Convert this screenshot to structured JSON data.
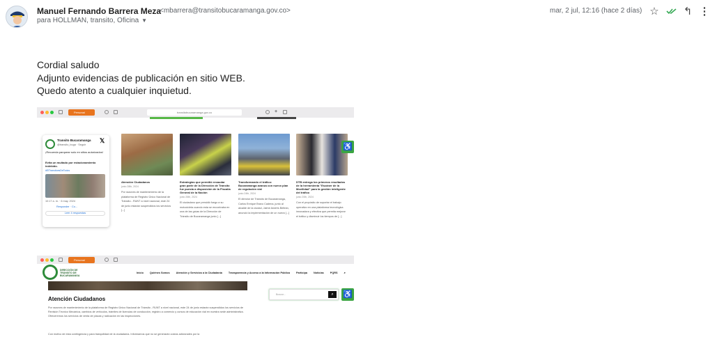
{
  "email": {
    "sender_name": "Manuel Fernando Barrera Meza",
    "sender_email": "<mbarrera@transitobucaramanga.gov.co>",
    "recipients": "para HOLLMAN, transito, Oficina",
    "date": "mar, 2 jul, 12:16 (hace 2 días)",
    "icons": [
      "star-icon",
      "read-check-icon",
      "reply-icon",
      "more-vert-icon"
    ],
    "body_lines": [
      "Cordial saludo",
      "Adjunto evidencias de publicación en sitio WEB.",
      "Quedo atento a cualquier inquietud."
    ]
  },
  "screenshot1": {
    "tab_label": "Personal",
    "url": "transitobucaramanga.gov.co",
    "tweet": {
      "name": "Transito Bucaramanga",
      "handle": "@transito_buga · Seguir",
      "line1": "¡Recuerda parquear solo en sitios autorizados!",
      "line2": "Evita un multado por estacionamiento indebido.",
      "hashtags": "#ElTransitoesDeTodos",
      "time": "10:17 a. m. · 6 may. 2024",
      "actions": "Responder · Co...",
      "read_replies": "Leer 4 respuestas"
    },
    "cards": [
      {
        "title": "Atención Ciudadanos",
        "date": "junio 28th, 2024",
        "text": "Por razones de mantenimiento de la plataforma de Registro Único Nacional de Tránsito - RUNT a nivel nacional, este 24 de junio estarán suspendidos los servicios [...]"
      },
      {
        "title": "Estrategias que permitió recaudar gran parte de la Dirección de Tránsito fue puesta a disposición de la Fiscalía General de la Nación",
        "date": "junio 26th, 2024",
        "text": "El ciudadano que presidió fuego a su motocicleta cuando esta se encontraba en una de las grúas de la Dirección de Tránsito de Bucaramanga junio [...]"
      },
      {
        "title": "Transformando el tráfico: Bucaramanga avanza con nuevo plan de regulación vial",
        "date": "junio 24th, 2024",
        "text": "El director de Tránsito de Bucaramanga, Carlos Enrique Bravo Cadena, junto al alcalde de la ciudad, Jaime Andrés Beltrán, anunció la implementación de un nuevo [...]"
      },
      {
        "title": "DTB entrega los primeros resultados de la herramienta \"Escáner de la Movilidad\" para la gestión inteligente del tráfico",
        "date": "junio 20th, 2024",
        "text": "Con el propósito de soportar el trabajo operativo en una plataforma tecnológica innovadora y efectiva que permita mejorar el tráfico y disminuir los tiempos de [...]"
      }
    ]
  },
  "screenshot2": {
    "tab_label": "Personal",
    "logo_text": "DIRECCIÓN DE TRÁNSITO DE BUCARAMANGA",
    "nav": [
      "Inicio",
      "Quiénes Somos",
      "Atención y Servicios a la Ciudadanía",
      "Transparencia y Acceso a la Información Pública",
      "Participa",
      "Noticias",
      "PQRS"
    ],
    "title": "Atención Ciudadanos",
    "paragraph1": "Por razones de mantenimiento de la plataforma de Registro Único Nacional de Tránsito - RUNT a nivel nacional, este 24 de junio estarán suspendidos los servicios de Revisión Técnico Mecánica, cambios de vehículos, trámites de licencias de conducción, registro a comercio y cursos de educación vial en nuestra sede administrativa. Ofreceremos los servicios de venta de placas y radicación en las inspecciones.",
    "paragraph2": "Con motivo de esta contingencia y para tranquilidad de la ciudadanía. Informamos que no se generarán costos adicionales por la",
    "search_placeholder": "Buscar..."
  },
  "colors": {
    "accent_green": "#3ba542",
    "brand_green": "#2e8b3a",
    "read_check": "#34a853"
  }
}
